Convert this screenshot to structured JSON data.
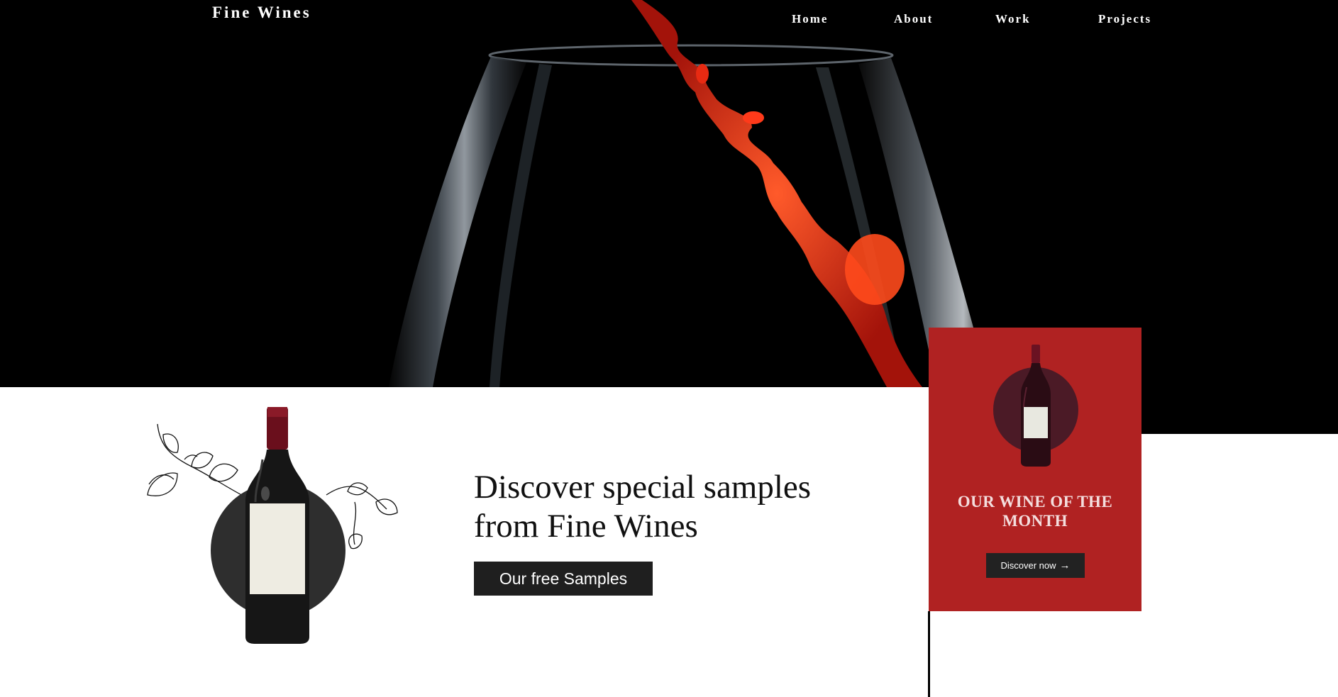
{
  "header": {
    "brand": "Fine Wines",
    "nav": [
      {
        "label": "Home"
      },
      {
        "label": "About"
      },
      {
        "label": "Work"
      },
      {
        "label": "Projects"
      }
    ]
  },
  "hero": {
    "image": "wine-glass-pouring-red-wine"
  },
  "promo": {
    "headline_line1": "Discover special samples",
    "headline_line2": "from Fine Wines",
    "button_label": "Our free Samples",
    "image": "wine-bottle-with-vine-illustration"
  },
  "card": {
    "title_line1": "OUR WINE OF THE",
    "title_line2": "MONTH",
    "button_label": "Discover now",
    "button_icon": "arrow-right-icon",
    "image": "red-wine-bottle",
    "colors": {
      "background": "#b02222",
      "button": "#222222"
    }
  },
  "colors": {
    "hero_bg": "#000000",
    "wine_red": "#e8301a"
  }
}
